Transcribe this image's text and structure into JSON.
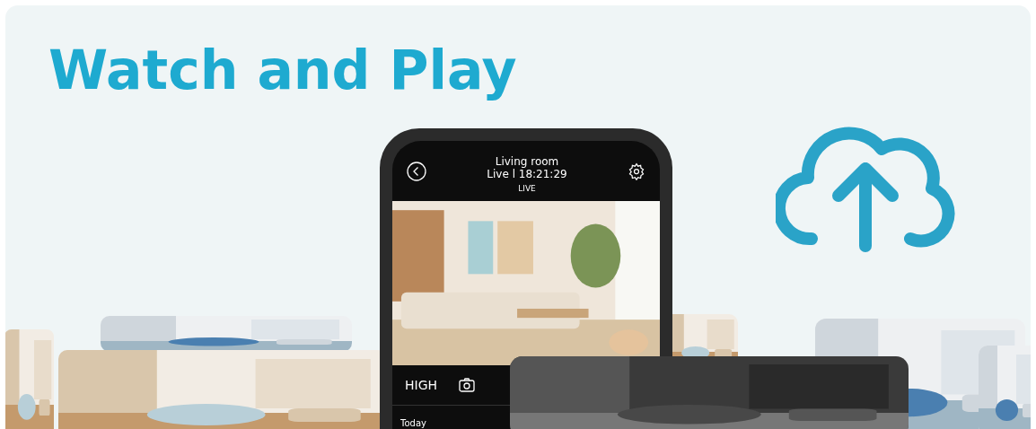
{
  "headline": "Watch and Play",
  "phone": {
    "camera_name": "Living room",
    "status": "Live l 18:21:29",
    "badge": "LIVE",
    "quality": "HIGH",
    "section": "Today"
  }
}
